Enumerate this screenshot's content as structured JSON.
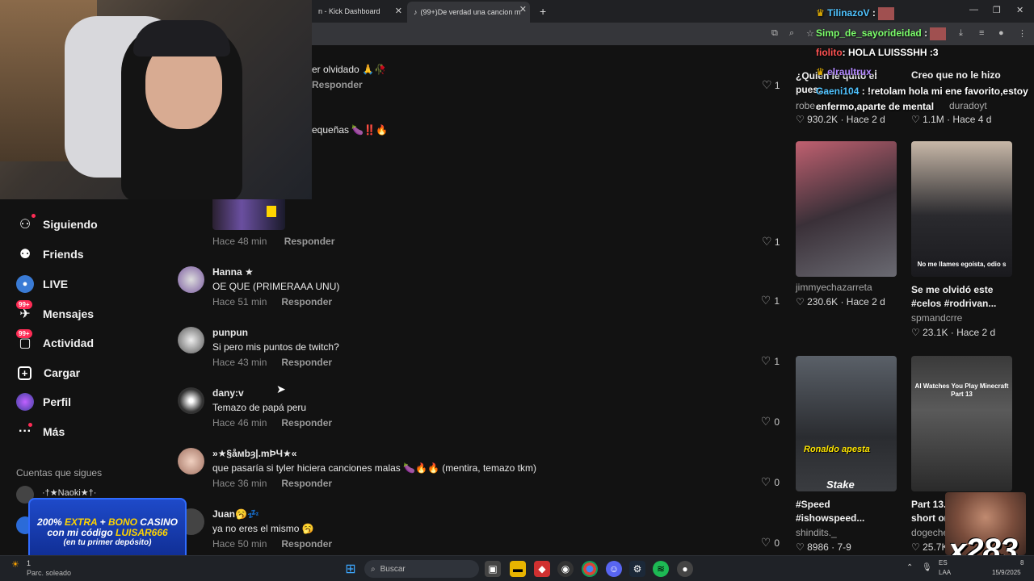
{
  "browser": {
    "tab1_title": "n - Kick Dashboard",
    "tab2_title": "(99+)De verdad una cancion m",
    "new_tab": "+"
  },
  "sidebar": {
    "items": [
      {
        "label": "Siguiendo",
        "icon": "following-icon"
      },
      {
        "label": "Friends",
        "icon": "friends-icon"
      },
      {
        "label": "LIVE",
        "icon": "live-icon"
      },
      {
        "label": "Mensajes",
        "icon": "messages-icon",
        "badge": "99+"
      },
      {
        "label": "Actividad",
        "icon": "activity-icon",
        "badge": "99+"
      },
      {
        "label": "Cargar",
        "icon": "upload-icon"
      },
      {
        "label": "Perfil",
        "icon": "profile-icon"
      },
      {
        "label": "Más",
        "icon": "more-icon"
      }
    ],
    "following_title": "Cuentas que sigues",
    "following_first": "·†★Naoki★†·"
  },
  "comments": {
    "partial": [
      {
        "text": "er olvidado 🙏🥀",
        "reply": "Responder",
        "likes": "1"
      },
      {
        "text": "equeñas 🍆‼️🔥"
      }
    ],
    "first": {
      "time": "Hace 48 min",
      "reply": "Responder",
      "likes": "1"
    },
    "list": [
      {
        "user": "Hanna ★",
        "text": "OE QUE (PRIMERAAA UNU)",
        "time": "Hace 51 min",
        "reply": "Responder",
        "likes": "1"
      },
      {
        "user": "punpun",
        "text": "Si pero mis puntos de twitch?",
        "time": "Hace 43 min",
        "reply": "Responder",
        "likes": "1"
      },
      {
        "user": "dany:v",
        "text": "Temazo de papá peru",
        "time": "Hace 46 min",
        "reply": "Responder",
        "likes": "0"
      },
      {
        "user": "»★§åмbȝ|.mÞЧ★«",
        "text": "que pasaría si tyler hiciera canciones malas 🍆🔥🔥 (mentira, temazo tkm)",
        "time": "Hace 36 min",
        "reply": "Responder",
        "likes": "0"
      },
      {
        "user": "Juan🥱💤",
        "text": "ya no eres el mismo 🥱",
        "time": "Hace 50 min",
        "reply": "Responder",
        "likes": "0"
      }
    ]
  },
  "videos": {
    "top_row": [
      {
        "title": "¿Quién le quitó el pues...",
        "author": "robe...",
        "stats": "930.2K · Hace 2 d"
      },
      {
        "title": "Creo que no le hizo",
        "author": "duradoyt",
        "stats": "1.1M · Hace 4 d"
      }
    ],
    "row2": [
      {
        "title": "",
        "author": "jimmyechazarreta",
        "stats": "230.6K · Hace 2 d",
        "overlay": ""
      },
      {
        "title": "Se me olvidó este #celos #rodrivan...",
        "author": "spmandcrre",
        "stats": "23.1K · Hace 2 d",
        "overlay": "No me llames egoísta, odio s"
      }
    ],
    "row3": [
      {
        "title": "#Speed #ishowspeed...",
        "author": "shindits._",
        "stats": "8986 · 7-9",
        "overlay": "Ronaldo apesta",
        "overlay2": "Stake"
      },
      {
        "title": "Part 13. short on",
        "author": "dogeche",
        "stats": "25.7K",
        "overlay": "AI Watches You Play Minecraft Part 13"
      }
    ]
  },
  "chat": [
    {
      "user": "TilinazoV",
      "msg": ":",
      "color": "#4fc3ff"
    },
    {
      "user": "Simp_de_sayorideidad",
      "msg": ":",
      "color": "#7cff6b"
    },
    {
      "user": "fiolito",
      "msg": ": HOLA LUISSSHH :3",
      "color": "#ff5252"
    },
    {
      "user": "elraultrux",
      "msg": ":",
      "color": "#b388ff"
    },
    {
      "user": "Gaeni104",
      "msg": ": !retolam hola mi ene favorito,estoy",
      "color": "#4fc3ff"
    },
    {
      "user": "",
      "msg": "enfermo,aparte de mental",
      "color": "#ffffff"
    }
  ],
  "promo": {
    "line1a": "200% ",
    "line1b": "EXTRA",
    "line1c": " + ",
    "line1d": "BONO",
    "line1e": " CASINO",
    "line2a": "con mi código ",
    "line2b": "LUISAR666",
    "line3": "(en tu primer depósito)"
  },
  "overlay_counter": "x283",
  "taskbar": {
    "search": "Buscar",
    "weather": "Parc. soleado",
    "weather_temp": "1",
    "lang1": "ES",
    "lang2": "LAA",
    "date": "15/9/2025",
    "time": "8"
  }
}
